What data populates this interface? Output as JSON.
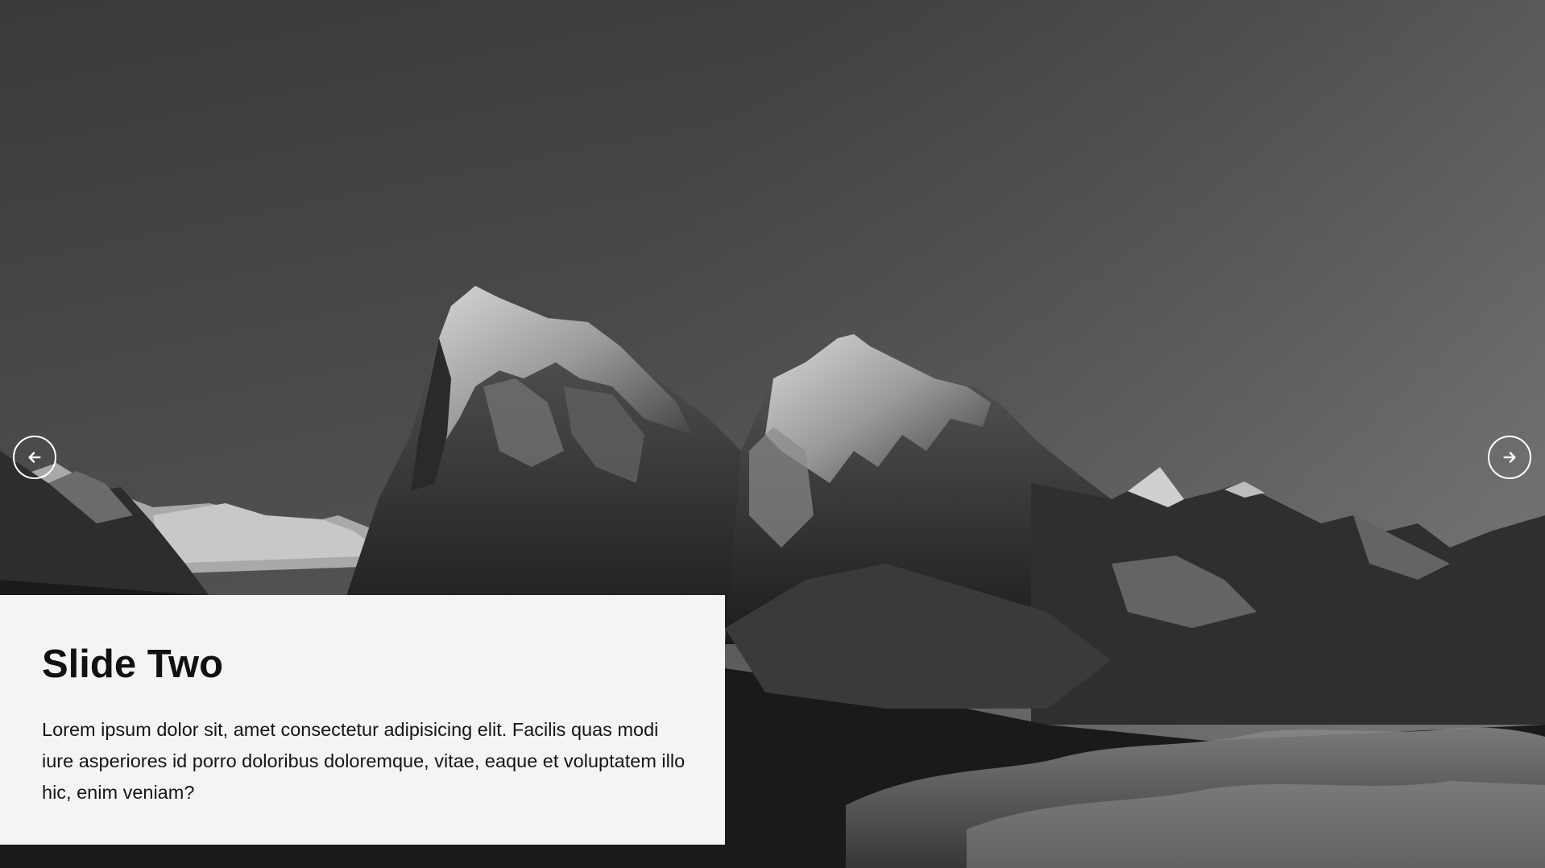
{
  "slider": {
    "prev_icon": "arrow-left-icon",
    "next_icon": "arrow-right-icon",
    "background_image": "black-and-white mountain range",
    "accent_color": "#ffffff"
  },
  "slide": {
    "title": "Slide Two",
    "body": "Lorem ipsum dolor sit, amet consectetur adipisicing elit. Facilis quas modi iure asperiores id porro doloribus doloremque, vitae, eaque et voluptatem illo hic, enim veniam?"
  },
  "colors": {
    "caption_bg": "#f4f4f4",
    "text": "#111111",
    "nav_ring": "#ffffff"
  }
}
